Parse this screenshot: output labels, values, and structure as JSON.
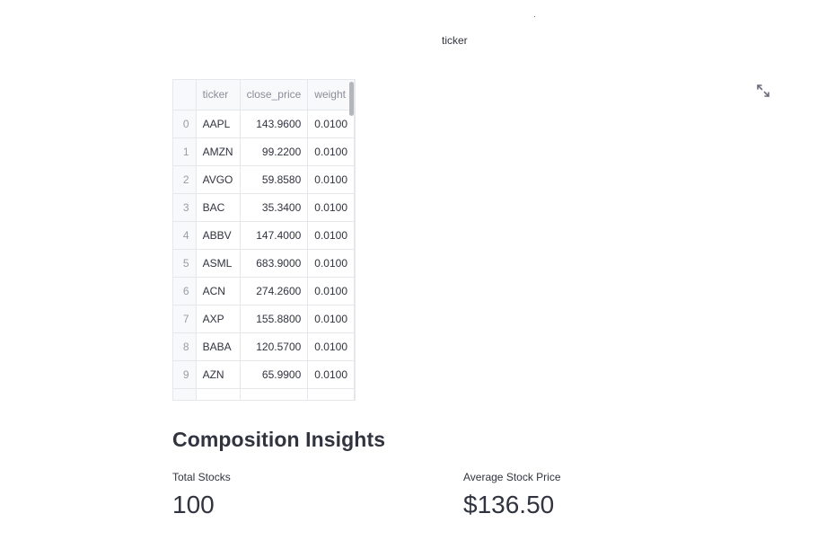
{
  "chart_axis": {
    "fragment": "·",
    "title": "ticker"
  },
  "icons": {
    "expand": "expand-icon"
  },
  "dataframe": {
    "columns": [
      "",
      "ticker",
      "close_price",
      "weight"
    ],
    "rows": [
      {
        "index": "0",
        "ticker": "AAPL",
        "close_price": "143.9600",
        "weight": "0.0100"
      },
      {
        "index": "1",
        "ticker": "AMZN",
        "close_price": "99.2200",
        "weight": "0.0100"
      },
      {
        "index": "2",
        "ticker": "AVGO",
        "close_price": "59.8580",
        "weight": "0.0100"
      },
      {
        "index": "3",
        "ticker": "BAC",
        "close_price": "35.3400",
        "weight": "0.0100"
      },
      {
        "index": "4",
        "ticker": "ABBV",
        "close_price": "147.4000",
        "weight": "0.0100"
      },
      {
        "index": "5",
        "ticker": "ASML",
        "close_price": "683.9000",
        "weight": "0.0100"
      },
      {
        "index": "6",
        "ticker": "ACN",
        "close_price": "274.2600",
        "weight": "0.0100"
      },
      {
        "index": "7",
        "ticker": "AXP",
        "close_price": "155.8800",
        "weight": "0.0100"
      },
      {
        "index": "8",
        "ticker": "BABA",
        "close_price": "120.5700",
        "weight": "0.0100"
      },
      {
        "index": "9",
        "ticker": "AZN",
        "close_price": "65.9900",
        "weight": "0.0100"
      }
    ]
  },
  "insights": {
    "title": "Composition Insights",
    "metrics": [
      {
        "label": "Total Stocks",
        "value": "100"
      },
      {
        "label": "Average Stock Price",
        "value": "$136.50"
      }
    ]
  }
}
